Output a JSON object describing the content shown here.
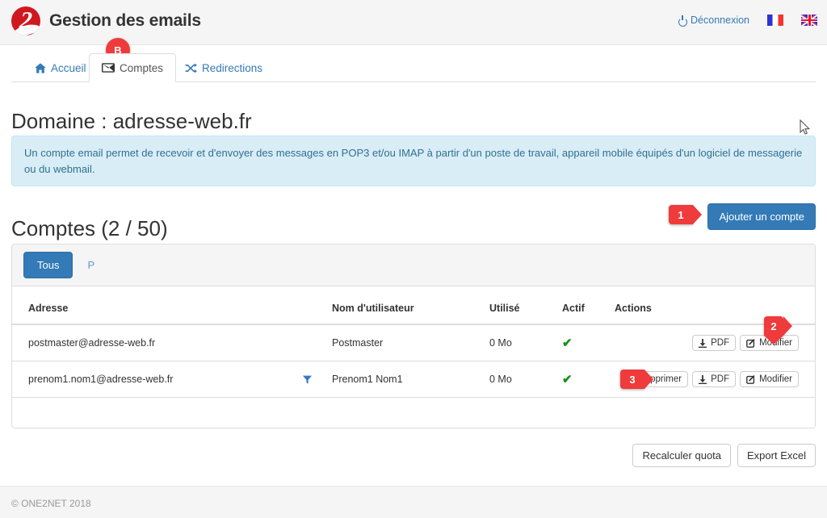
{
  "header": {
    "brand_title": "Gestion des emails",
    "logo_name": "one2net-logo",
    "logout_label": "Déconnexion",
    "logout_icon": "power-icon",
    "flags": [
      {
        "name": "flag-fr",
        "label": "Français"
      },
      {
        "name": "flag-uk",
        "label": "English"
      }
    ]
  },
  "nav": {
    "tabs": [
      {
        "label": "Accueil",
        "icon": "home-icon",
        "active": false
      },
      {
        "label": "Comptes",
        "icon": "envelope-icon",
        "active": true
      },
      {
        "label": "Redirections",
        "icon": "shuffle-icon",
        "active": false
      }
    ]
  },
  "main": {
    "page_title": "Domaine : adresse-web.fr",
    "alert_text": "Un compte email permet de recevoir et d'envoyer des messages en POP3 et/ou IMAP à partir d'un poste de travail, appareil mobile équipés d'un logiciel de messagerie ou du webmail.",
    "section_title": "Comptes (2 / 50)",
    "add_account_label": "Ajouter un compte",
    "filters": [
      {
        "label": "Tous",
        "active": true
      },
      {
        "label": "P",
        "active": false
      }
    ],
    "table": {
      "columns": [
        "Adresse",
        "Nom d'utilisateur",
        "Utilisé",
        "Actif",
        "Actions"
      ],
      "rows": [
        {
          "adresse": "postmaster@adresse-web.fr",
          "has_filter_icon": false,
          "nom_utilisateur": "Postmaster",
          "utilise": "0 Mo",
          "actif": "✔",
          "actions": [
            {
              "label": "PDF",
              "icon": "download-icon"
            },
            {
              "label": "Modifier",
              "icon": "edit-icon"
            }
          ]
        },
        {
          "adresse": "prenom1.nom1@adresse-web.fr",
          "has_filter_icon": true,
          "nom_utilisateur": "Prenom1 Nom1",
          "utilise": "0 Mo",
          "actif": "✔",
          "actions": [
            {
              "label": "Supprimer",
              "icon": "trash-icon"
            },
            {
              "label": "PDF",
              "icon": "download-icon"
            },
            {
              "label": "Modifier",
              "icon": "edit-icon"
            }
          ]
        }
      ]
    },
    "bottom_buttons": [
      {
        "label": "Recalculer quota"
      },
      {
        "label": "Export Excel"
      }
    ]
  },
  "footer": {
    "copyright": "© ONE2NET 2018"
  },
  "markers": [
    {
      "id": "marker-b",
      "label": "B",
      "shape": "circle"
    },
    {
      "id": "marker-1",
      "label": "1",
      "shape": "tag"
    },
    {
      "id": "marker-2",
      "label": "2",
      "shape": "tag"
    },
    {
      "id": "marker-3",
      "label": "3",
      "shape": "tag"
    }
  ],
  "colors": {
    "brand_red": "#d0191f",
    "primary_blue": "#337ab7",
    "marker_red": "#ef3b3b",
    "info_bg": "#d9edf7",
    "info_border": "#bce8f1",
    "info_text": "#31708f",
    "success_green": "#169016"
  }
}
